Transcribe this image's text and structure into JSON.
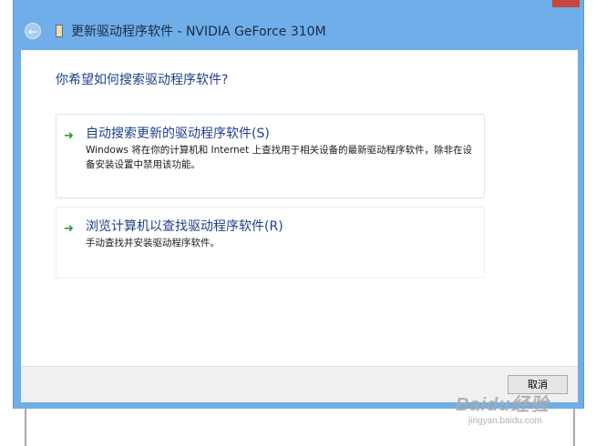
{
  "window": {
    "title": "更新驱动程序软件 - NVIDIA GeForce 310M",
    "back_icon": "back-arrow-icon",
    "device_icon": "device-icon"
  },
  "main": {
    "question": "你希望如何搜索驱动程序软件?",
    "options": [
      {
        "icon": "green-arrow-icon",
        "title": "自动搜索更新的驱动程序软件(S)",
        "description": "Windows 将在你的计算机和 Internet 上查找用于相关设备的最新驱动程序软件，除非在设备安装设置中禁用该功能。"
      },
      {
        "icon": "green-arrow-icon",
        "title": "浏览计算机以查找驱动程序软件(R)",
        "description": "手动查找并安装驱动程序软件。"
      }
    ]
  },
  "footer": {
    "cancel_label": "取消"
  },
  "watermark": {
    "brand": "Baidu经验",
    "url": "jingyan.baidu.com"
  },
  "colors": {
    "title_bar": "#6faee8",
    "link_blue": "#1e3f8c",
    "arrow_green": "#2c9a2c"
  }
}
